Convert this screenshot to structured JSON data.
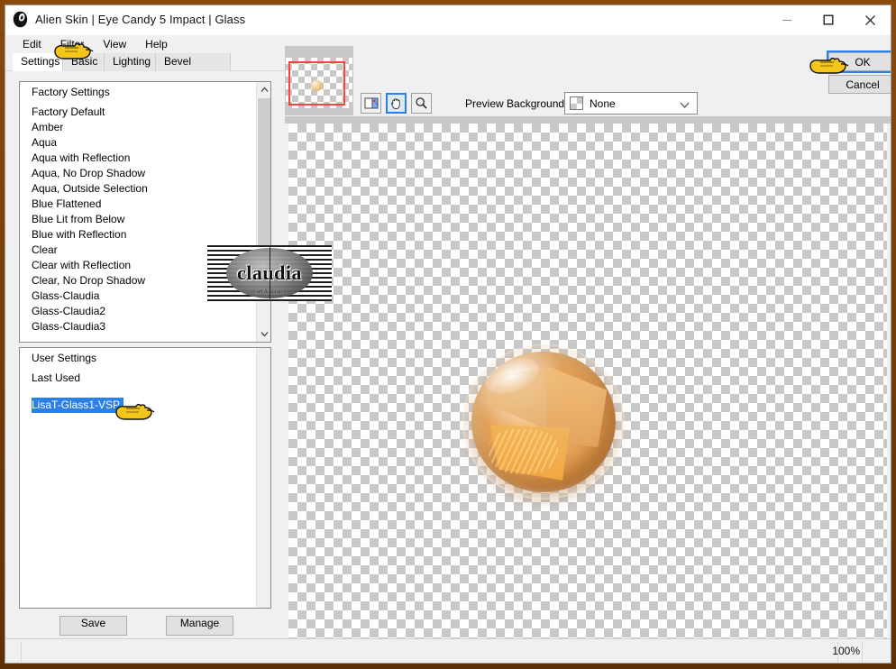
{
  "window": {
    "title": "Alien Skin | Eye Candy 5 Impact | Glass",
    "app_icon": "alienskin-icon",
    "controls": {
      "minimize": "minimize-icon",
      "maximize": "maximize-icon",
      "close": "close-icon"
    }
  },
  "menubar": {
    "items": [
      "Edit",
      "Filter",
      "View",
      "Help"
    ]
  },
  "tabs": [
    {
      "label": "Settings",
      "active": true
    },
    {
      "label": "Basic",
      "active": false
    },
    {
      "label": "Lighting",
      "active": false
    },
    {
      "label": "Bevel Profile",
      "active": false
    }
  ],
  "factory_list": {
    "header": "Factory Settings",
    "items": [
      "Factory Default",
      "Amber",
      "Aqua",
      "Aqua with Reflection",
      "Aqua, No Drop Shadow",
      "Aqua, Outside Selection",
      "Blue Flattened",
      "Blue Lit from Below",
      "Blue with Reflection",
      "Clear",
      "Clear with Reflection",
      "Clear, No Drop Shadow",
      "Glass-Claudia",
      "Glass-Claudia2",
      "Glass-Claudia3"
    ],
    "scroll_up_icon": "chevron-up-icon",
    "scroll_down_icon": "chevron-down-icon"
  },
  "user_list": {
    "header": "User Settings",
    "items": [
      "Last Used"
    ],
    "selected": "LisaT-Glass1-VSP"
  },
  "panel_buttons": {
    "save": "Save",
    "manage": "Manage"
  },
  "preview_toolbar": {
    "tools": [
      {
        "name": "preview-compare-tool",
        "selected": false
      },
      {
        "name": "hand-tool",
        "selected": true
      },
      {
        "name": "zoom-tool",
        "selected": false
      }
    ],
    "background_label": "Preview Background:",
    "background_value": "None",
    "background_swatch": "checkerboard-swatch",
    "chevron": "chevron-down-icon"
  },
  "dialog_buttons": {
    "ok": "OK",
    "cancel": "Cancel"
  },
  "statusbar": {
    "zoom": "100%"
  },
  "watermark": {
    "text": "claudia",
    "sub": "art & scrap"
  },
  "colors": {
    "frame_brown": "#7a3f08",
    "accent_blue": "#2a7fe8",
    "selection_blue": "#2a7fe8",
    "nav_rect_red": "#ff4040",
    "checker_gray": "#c8c8c8",
    "panel_gray": "#f0f0f0",
    "sphere_amber": "#e8a255"
  },
  "pointers": [
    {
      "name": "pointer-cursor-menu"
    },
    {
      "name": "pointer-cursor-user-setting"
    },
    {
      "name": "pointer-cursor-ok"
    }
  ]
}
